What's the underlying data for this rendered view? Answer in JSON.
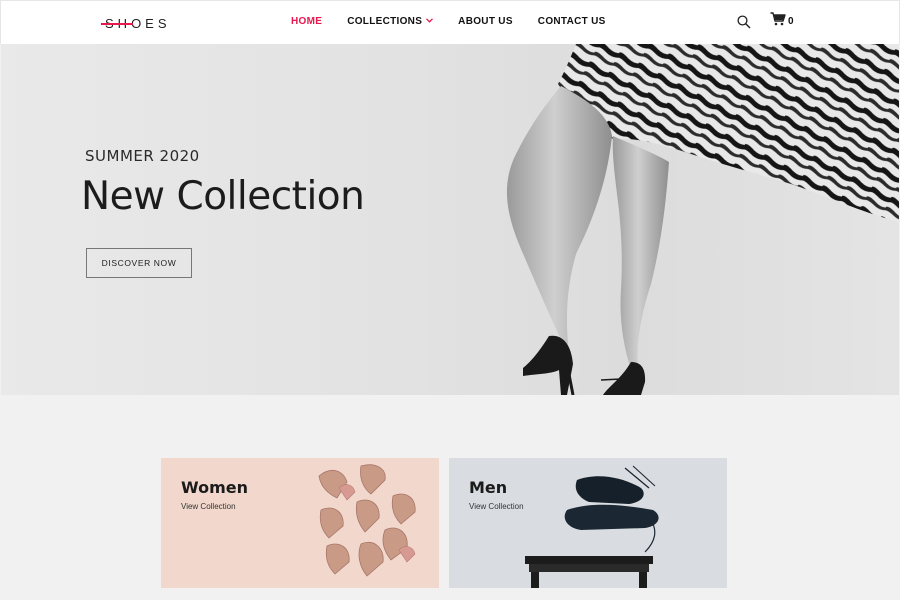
{
  "brand": {
    "logo_accent": "SH",
    "logo_rest": "OES"
  },
  "nav": {
    "items": [
      {
        "label": "HOME",
        "active": true
      },
      {
        "label": "COLLECTIONS",
        "has_dropdown": true
      },
      {
        "label": "ABOUT US"
      },
      {
        "label": "CONTACT US"
      }
    ]
  },
  "header_actions": {
    "search_icon": "search-icon",
    "cart_icon": "cart-icon",
    "cart_count": "0"
  },
  "hero": {
    "eyebrow": "SUMMER 2020",
    "title": "New Collection",
    "cta_label": "DISCOVER NOW"
  },
  "categories": [
    {
      "title": "Women",
      "link": "View Collection"
    },
    {
      "title": "Men",
      "link": "View Collection"
    }
  ],
  "colors": {
    "accent": "#e8174d",
    "women_bg": "#f2d8cc",
    "men_bg": "#d9dde1",
    "page_bg": "#f1f1f1"
  }
}
